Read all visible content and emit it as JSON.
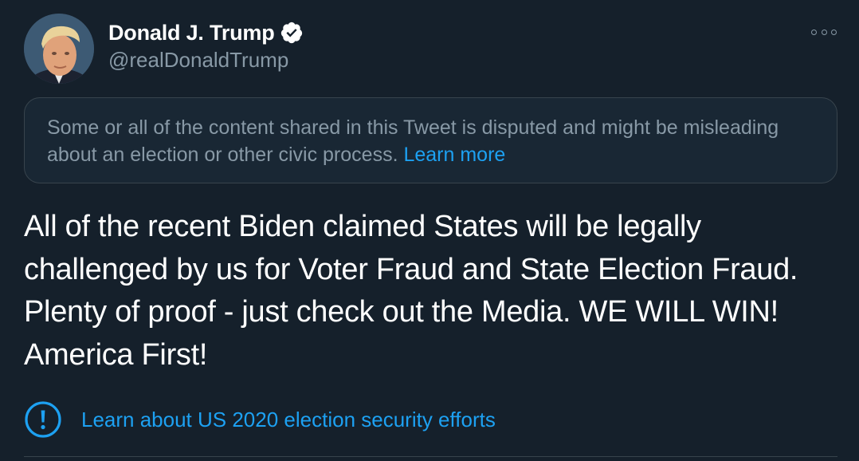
{
  "tweet": {
    "author": {
      "display_name": "Donald J. Trump",
      "handle": "@realDonaldTrump",
      "verified": true,
      "avatar_icon": "profile-photo"
    },
    "more_icon": "more-options-icon",
    "notice": {
      "text": "Some or all of the content shared in this Tweet is disputed and might be misleading about an election or other civic process.",
      "link_label": "Learn more"
    },
    "body": "All of the recent Biden claimed States will be legally challenged by us for Voter Fraud and State Election Fraud. Plenty of proof - just check out the Media. WE WILL WIN! America First!",
    "election_label": {
      "icon": "alert-circle-icon",
      "link_text": "Learn about US 2020 election security efforts"
    }
  },
  "colors": {
    "background": "#15202b",
    "notice_background": "#192734",
    "border": "#38444d",
    "secondary_text": "#8899a6",
    "accent": "#1da1f2",
    "primary_text": "#ffffff"
  }
}
